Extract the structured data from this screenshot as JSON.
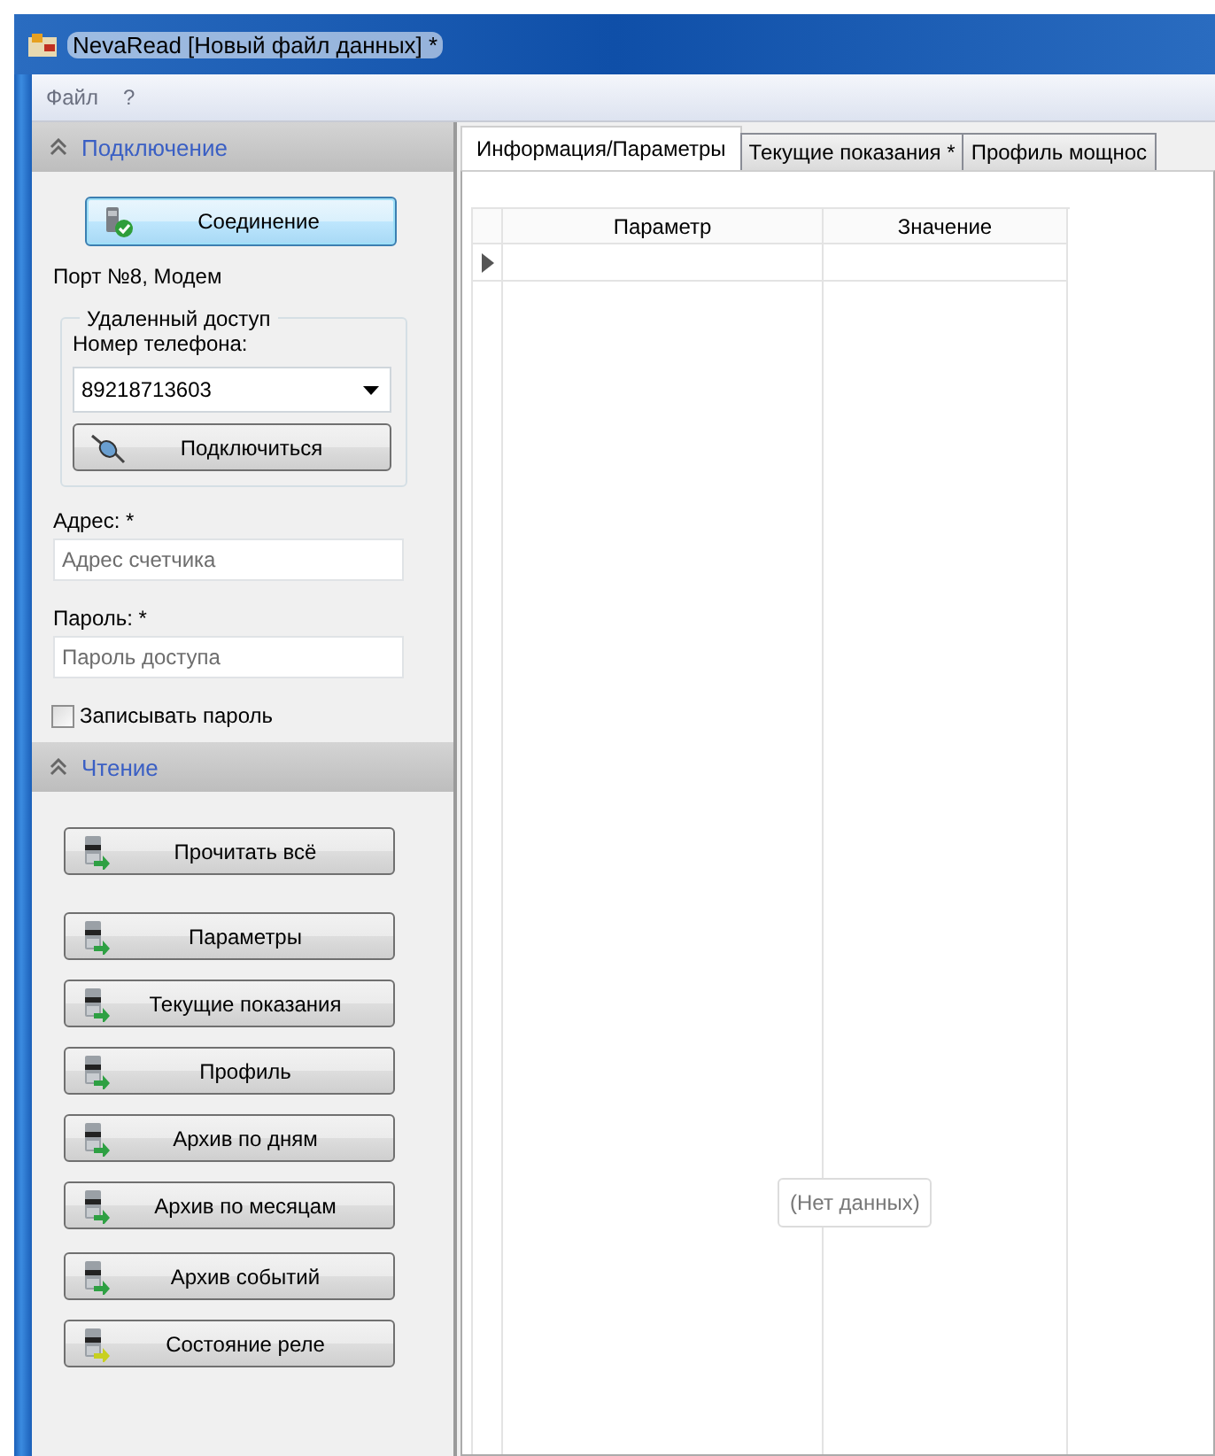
{
  "window": {
    "title": "NevaRead [Новый файл данных] *"
  },
  "menu": [
    {
      "label": "Файл"
    },
    {
      "label": "?"
    }
  ],
  "connection": {
    "header": "Подключение",
    "connect_button": "Соединение",
    "port_status": "Порт №8, Модем",
    "remote_access": {
      "legend": "Удаленный доступ",
      "phone_label": "Номер телефона:",
      "phone_value": "89218713603",
      "dial_button": "Подключиться"
    },
    "address": {
      "label": "Адрес: *",
      "placeholder": "Адрес счетчика"
    },
    "password": {
      "label": "Пароль: *",
      "placeholder": "Пароль доступа"
    },
    "save_password": {
      "label": "Записывать пароль",
      "checked": false
    }
  },
  "reading": {
    "header": "Чтение",
    "buttons": [
      {
        "label": "Прочитать всё",
        "kind": "read"
      },
      {
        "label": "Параметры",
        "kind": "read"
      },
      {
        "label": "Текущие показания",
        "kind": "read"
      },
      {
        "label": "Профиль",
        "kind": "read"
      },
      {
        "label": "Архив по дням",
        "kind": "read"
      },
      {
        "label": "Архив по месяцам",
        "kind": "read"
      },
      {
        "label": "Архив событий",
        "kind": "read"
      },
      {
        "label": "Состояние реле",
        "kind": "relay"
      }
    ]
  },
  "tabs": [
    {
      "label": "Информация/Параметры",
      "selected": true
    },
    {
      "label": "Текущие показания *",
      "selected": false
    },
    {
      "label": "Профиль мощнос",
      "selected": false
    }
  ],
  "table": {
    "columns": [
      "Параметр",
      "Значение"
    ],
    "empty_message": "(Нет данных)"
  }
}
